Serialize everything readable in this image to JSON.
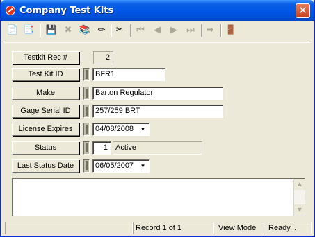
{
  "window": {
    "title": "Company Test Kits",
    "close_glyph": "✕"
  },
  "toolbar": {
    "buttons": [
      {
        "name": "copy-record-icon",
        "glyph": "📄",
        "enabled": false
      },
      {
        "name": "new-record-icon",
        "glyph": "📑",
        "enabled": true
      },
      {
        "name": "save-icon",
        "glyph": "💾",
        "enabled": false
      },
      {
        "name": "delete-icon",
        "glyph": "✖",
        "enabled": false
      },
      {
        "name": "books-icon",
        "glyph": "📚",
        "enabled": true
      },
      {
        "name": "edit-pencil-icon",
        "glyph": "✏",
        "enabled": true
      },
      {
        "name": "cut-icon",
        "glyph": "✂",
        "enabled": true
      },
      {
        "name": "first-record-icon",
        "glyph": "⏮",
        "enabled": false
      },
      {
        "name": "prev-record-icon",
        "glyph": "◀",
        "enabled": false
      },
      {
        "name": "next-record-icon",
        "glyph": "▶",
        "enabled": false
      },
      {
        "name": "last-record-icon",
        "glyph": "⏭",
        "enabled": false
      },
      {
        "name": "goto-icon",
        "glyph": "➡",
        "enabled": false
      },
      {
        "name": "exit-icon",
        "glyph": "🚪",
        "enabled": true
      }
    ]
  },
  "form": {
    "rec_label": "Testkit Rec #",
    "rec_value": "2",
    "test_kit_id_label": "Test Kit ID",
    "test_kit_id_value": "BFR1",
    "make_label": "Make",
    "make_value": "Barton Regulator",
    "gage_serial_label": "Gage Serial ID",
    "gage_serial_value": "257/259 BRT",
    "license_label": "License Expires",
    "license_value": "04/08/2008",
    "status_label": "Status",
    "status_code": "1",
    "status_text": "Active",
    "last_status_label": "Last Status Date",
    "last_status_value": "06/05/2007",
    "dropdown_glyph": "▼"
  },
  "memo": {
    "value": "",
    "up_glyph": "▲",
    "down_glyph": "▼"
  },
  "statusbar": {
    "record": "Record 1 of 1",
    "mode": "View Mode",
    "state": "Ready..."
  }
}
